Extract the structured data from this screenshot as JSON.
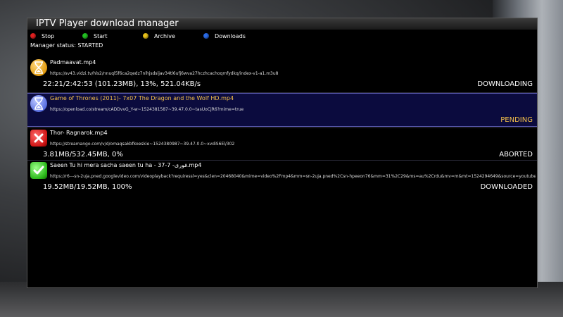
{
  "window": {
    "title": "IPTV Player download manager"
  },
  "legend": [
    {
      "label": "Stop",
      "color": "#e02020"
    },
    {
      "label": "Start",
      "color": "#22c022"
    },
    {
      "label": "Archive",
      "color": "#e8c21a"
    },
    {
      "label": "Downloads",
      "color": "#2a6be8"
    }
  ],
  "status": "Manager status: STARTED",
  "downloads": [
    {
      "name": "Padmaavat.mp4",
      "url": "https://sv43.vidzi.tv/hls2/nnuql5f6ca2qedz7nlhjsdsljav34tl6ufj6wva27hczhcachoqmfydkq/index-v1-a1.m3u8",
      "progress": "22:21/2:42:53 (101.23MB), 13%, 521.04KB/s",
      "state": "DOWNLOADING",
      "icon": "hourglass-icon"
    },
    {
      "name": "Game of Thrones (2011)- 7x07 The Dragon and the Wolf HD.mp4",
      "url": "https://openload.co/stream/cADDvvG_Y-w~1524381587~39.47.0.0~tasUoCjR6?mime=true",
      "progress": "",
      "state": "PENDING",
      "icon": "hourglass-icon"
    },
    {
      "name": "Thor- Ragnarok.mp4",
      "url": "https://streamango.com/v/d/omaqsakbfkoeskie~1524380987~39.47.0.0~xvdiS6El/302",
      "progress": "3.81MB/532.45MB, 0%",
      "state": "ABORTED",
      "icon": "aborted-icon"
    },
    {
      "name": "Saeen Tu hi mera sacha saeen tu ha - 37-7 -فوری.mp4",
      "url": "https://r6---sn-2uja.pned.googlevideo.com/videoplayback?requiressl=yes&clen=20468040&mime=video%2Fmp4&mm=sn-2uja.pned%2Csn-hpeeon76&mm=31%2C29&ms=au%2Crdu&mv=m&mt=1524294649&source=youtube&ip=39",
      "progress": "19.52MB/19.52MB, 100%",
      "state": "DOWNLOADED",
      "icon": "checkmark-icon"
    }
  ]
}
